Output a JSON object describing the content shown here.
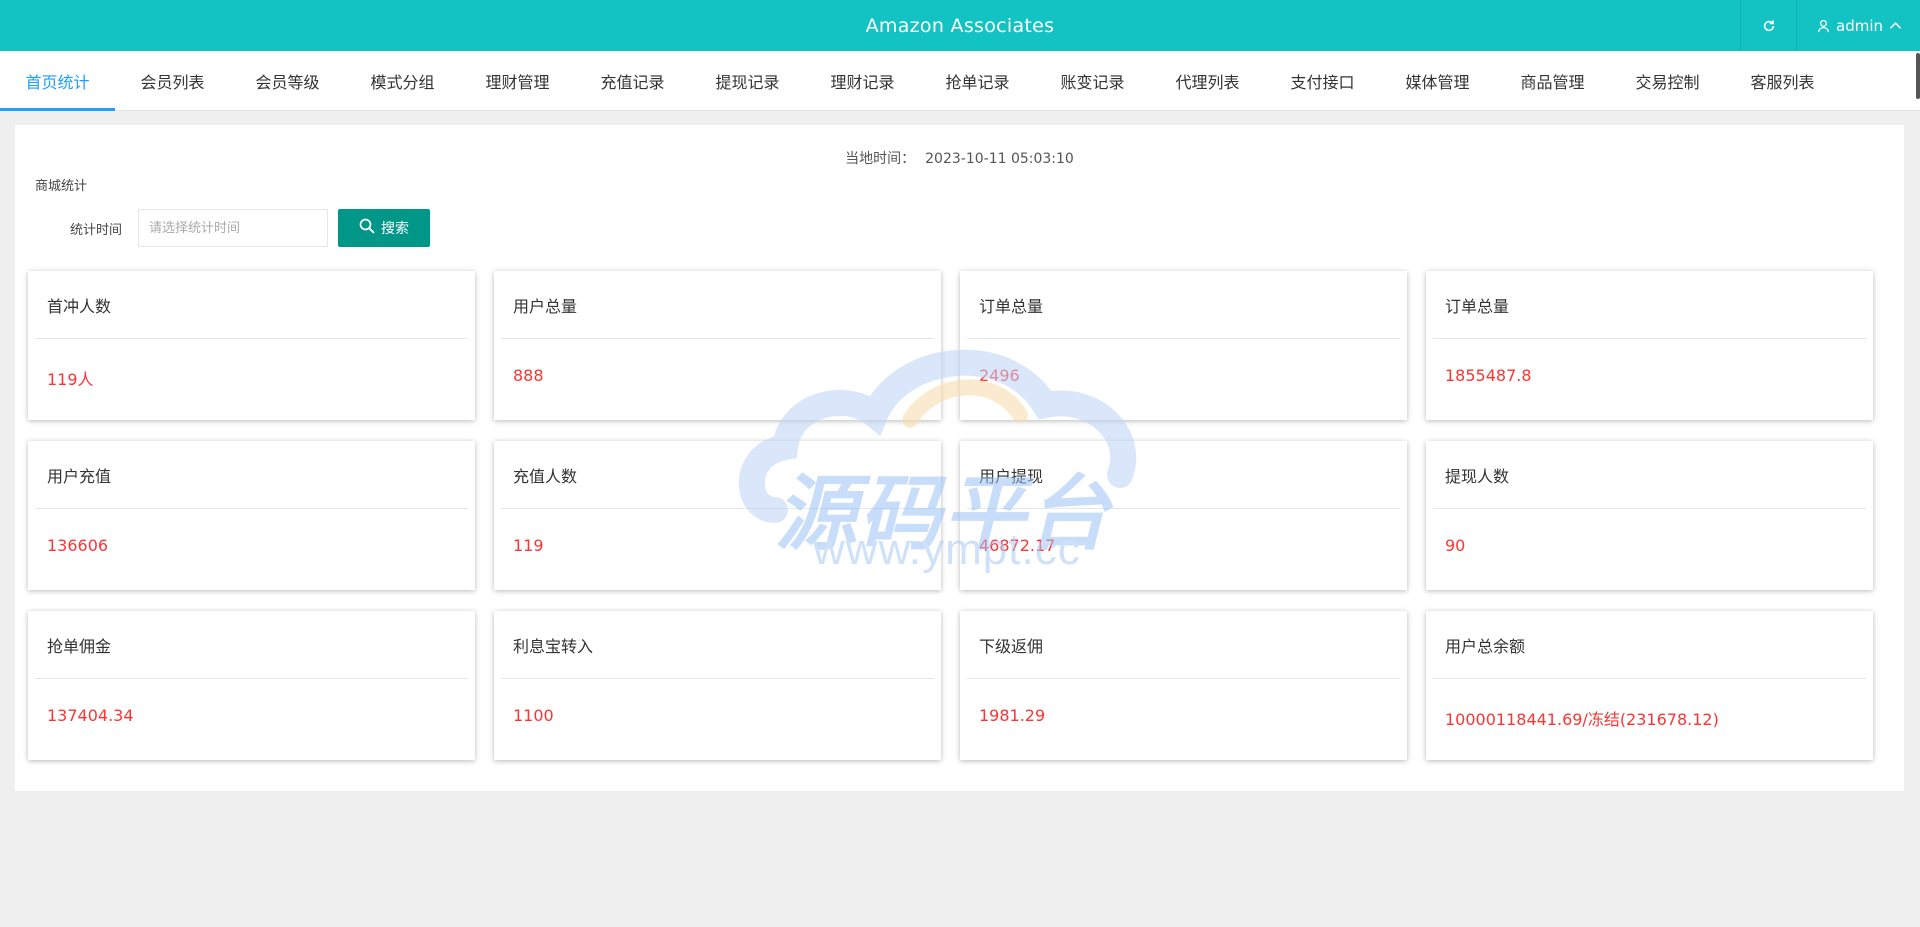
{
  "header": {
    "title": "Amazon Associates",
    "user": "admin",
    "colors": {
      "bar": "#13c2c2"
    },
    "icons": {
      "refresh": "refresh-icon",
      "user": "user-icon",
      "expand": "chevron-up-icon"
    }
  },
  "nav": {
    "active_index": 0,
    "tabs": [
      "首页统计",
      "会员列表",
      "会员等级",
      "模式分组",
      "理财管理",
      "充值记录",
      "提现记录",
      "理财记录",
      "抢单记录",
      "账变记录",
      "代理列表",
      "支付接口",
      "媒体管理",
      "商品管理",
      "交易控制",
      "客服列表"
    ]
  },
  "main": {
    "time_label": "当地时间：",
    "time_value": "2023-10-11 05:03:10",
    "section_title": "商城统计",
    "filter": {
      "label": "统计时间",
      "placeholder": "请选择统计时间",
      "value": "",
      "search_label": "搜索"
    }
  },
  "cards": [
    {
      "title": "首冲人数",
      "value": "119人"
    },
    {
      "title": "用户总量",
      "value": "888"
    },
    {
      "title": "订单总量",
      "value": "2496"
    },
    {
      "title": "订单总量",
      "value": "1855487.8"
    },
    {
      "title": "用户充值",
      "value": "136606"
    },
    {
      "title": "充值人数",
      "value": "119"
    },
    {
      "title": "用户提现",
      "value": "46872.17"
    },
    {
      "title": "提现人数",
      "value": "90"
    },
    {
      "title": "抢单佣金",
      "value": "137404.34"
    },
    {
      "title": "利息宝转入",
      "value": "1100"
    },
    {
      "title": "下级返佣",
      "value": "1981.29"
    },
    {
      "title": "用户总余额",
      "value": "10000118441.69/冻结(231678.12)"
    }
  ],
  "watermark": {
    "title": "源码平台",
    "url": "www.ympt.cc"
  },
  "colors": {
    "accent": "#1e9fff",
    "button": "#009688",
    "value": "#ff3333"
  }
}
